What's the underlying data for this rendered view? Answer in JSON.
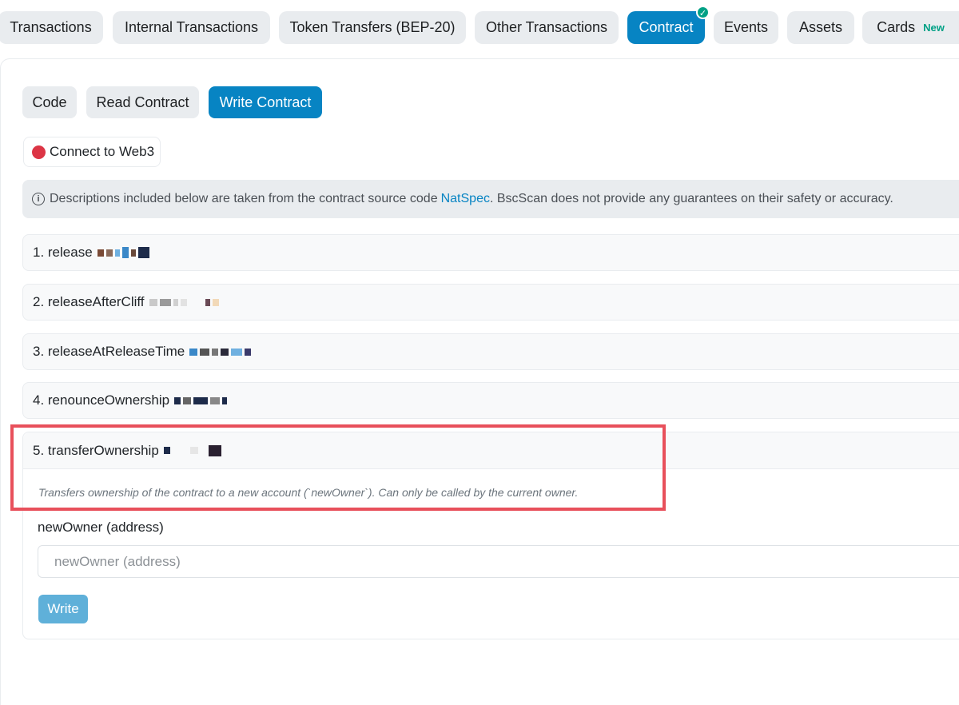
{
  "tabs": [
    {
      "label": "Transactions"
    },
    {
      "label": "Internal Transactions"
    },
    {
      "label": "Token Transfers (BEP-20)"
    },
    {
      "label": "Other Transactions"
    },
    {
      "label": "Contract",
      "active": true
    },
    {
      "label": "Events"
    },
    {
      "label": "Assets"
    },
    {
      "label": "Cards",
      "badge": "New"
    }
  ],
  "subtabs": [
    {
      "label": "Code"
    },
    {
      "label": "Read Contract"
    },
    {
      "label": "Write Contract",
      "active": true
    }
  ],
  "connect": {
    "label": "Connect to Web3",
    "status_color": "#dc3545"
  },
  "info": {
    "icon": "info-icon",
    "text_before": "Descriptions included below are taken from the contract source code",
    "link": "NatSpec",
    "text_after": ". BscScan does not provide any guarantees on their safety or accuracy."
  },
  "functions": [
    {
      "label": "1. release"
    },
    {
      "label": "2. releaseAfterCliff"
    },
    {
      "label": "3. releaseAtReleaseTime"
    },
    {
      "label": "4. renounceOwnership"
    }
  ],
  "open_function": {
    "label": "5. transferOwnership",
    "description": "Transfers ownership of the contract to a new account (`newOwner`). Can only be called by the current owner.",
    "param_label": "newOwner (address)",
    "param_placeholder": "newOwner (address)",
    "write_label": "Write"
  },
  "colors": {
    "accent": "#0784c3",
    "tab_bg": "#e9ecef",
    "highlight": "#e8505b",
    "badge_green": "#00a186"
  }
}
